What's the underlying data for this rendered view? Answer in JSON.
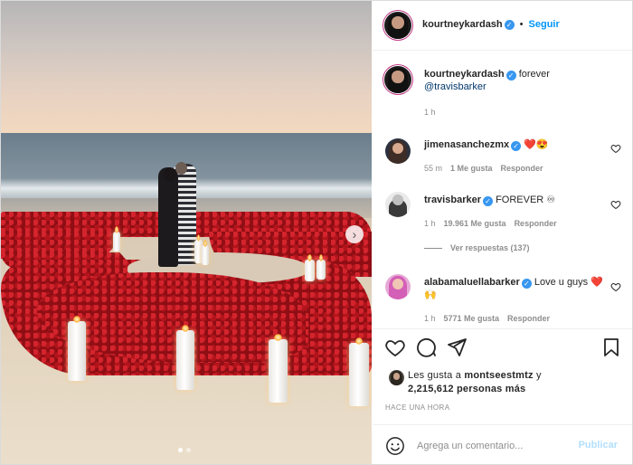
{
  "post": {
    "author": "kourtneykardash",
    "follow_label": "Seguir",
    "caption_text": "forever",
    "caption_mention": "@travisbarker",
    "caption_time": "1 h"
  },
  "comments": [
    {
      "username": "jimenasanchezmx",
      "text": "❤️😍",
      "time": "55 m",
      "likes": "1 Me gusta",
      "reply": "Responder"
    },
    {
      "username": "travisbarker",
      "text": "FOREVER ♾",
      "time": "1 h",
      "likes": "19.961 Me gusta",
      "reply": "Responder"
    },
    {
      "username": "alabamaluellabarker",
      "text": "Love u guys ❤️🙌",
      "time": "1 h",
      "likes": "5771 Me gusta",
      "reply": "Responder"
    }
  ],
  "view_replies": "Ver respuestas (137)",
  "likes_line1_prefix": "Les gusta a ",
  "likes_line1_user": "montseestmtz",
  "likes_line1_suffix": " y",
  "likes_line2": "2,215,612 personas más",
  "timestamp": "HACE UNA HORA",
  "add_comment_placeholder": "Agrega un comentario...",
  "publish_label": "Publicar",
  "carousel": {
    "slides": 2,
    "current": 1
  },
  "colors": {
    "accent": "#0095f6",
    "verified": "#3897f0",
    "heart": "#ed4956"
  },
  "icons": [
    "heart-icon",
    "comment-icon",
    "share-icon",
    "bookmark-icon",
    "emoji-icon",
    "chevron-right-icon",
    "verified-icon"
  ]
}
